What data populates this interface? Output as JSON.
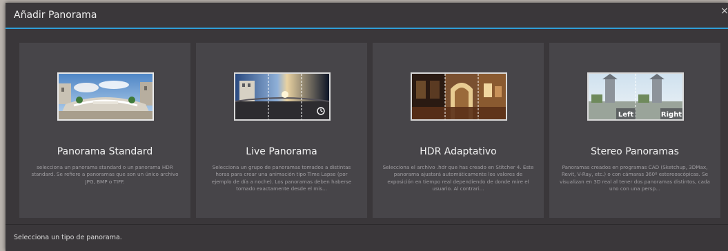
{
  "dialog": {
    "title": "Añadir Panorama",
    "close_glyph": "×",
    "status": "Selecciona un tipo de panorama."
  },
  "cards": [
    {
      "title": "Panorama Standard",
      "description": "selecciona un panorama standard o un panorama HDR standard. Se refiere a panoramas que son un único archivo JPG, BMP o TIFF."
    },
    {
      "title": "Live Panorama",
      "description": "Selecciona un grupo de panoramas tomados a distintas horas para crear una animación tipo Time Lapse (por ejemplo de día a noche). Los panoramas deben haberse tomado exactamente desde el mis..."
    },
    {
      "title": "HDR Adaptativo",
      "description": "Selecciona el archivo .hdr que has creado en Stitcher 4. Este panorama ajustará automáticamente los valores de exposición en tiempo real dependiendo de donde mire el usuario. Al contrari..."
    },
    {
      "title": "Stereo Panoramas",
      "description": "Panoramas creados en programas CAD (Sketchup, 3DMax, Revit, V-Ray, etc.) o con cámaras 360º estereoscópicas. Se visualizan en 3D real al tener dos panoramas distintos, cada uno con una persp...",
      "thumb_left_label": "Left",
      "thumb_right_label": "Right"
    }
  ],
  "colors": {
    "dialog_bg": "#3a373a",
    "card_bg": "#474549",
    "accent": "#2f9fd8"
  }
}
